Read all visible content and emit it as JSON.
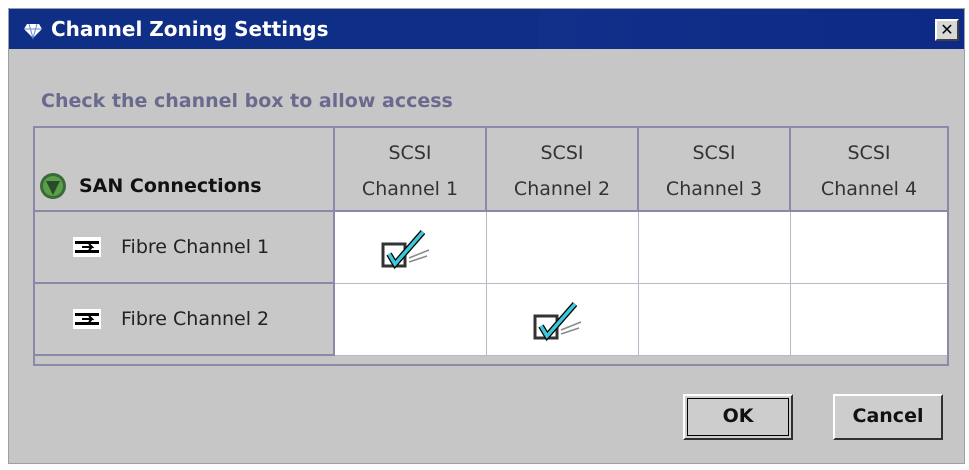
{
  "window": {
    "title": "Channel Zoning Settings",
    "close_glyph": "✕"
  },
  "instruction": "Check the channel box to allow access",
  "grid": {
    "corner_label": "SAN Connections",
    "columns": [
      {
        "line1": "SCSI",
        "line2": "Channel 1"
      },
      {
        "line1": "SCSI",
        "line2": "Channel 2"
      },
      {
        "line1": "SCSI",
        "line2": "Channel 3"
      },
      {
        "line1": "SCSI",
        "line2": "Channel 4"
      }
    ],
    "rows": [
      {
        "label": "Fibre Channel 1",
        "checked": [
          true,
          false,
          false,
          false
        ]
      },
      {
        "label": "Fibre Channel 2",
        "checked": [
          false,
          true,
          false,
          false
        ]
      }
    ]
  },
  "buttons": {
    "ok": "OK",
    "cancel": "Cancel"
  },
  "colors": {
    "titlebar": "#0f2f86",
    "dialog_bg": "#c6c6c6",
    "instruction_text": "#6a6a8e",
    "check_accent": "#3cc8d8"
  },
  "icons": {
    "title": "gem-icon",
    "corner": "green-shield-icon",
    "row": "fibre-link-icon",
    "checked": "checkmark-box-icon"
  }
}
